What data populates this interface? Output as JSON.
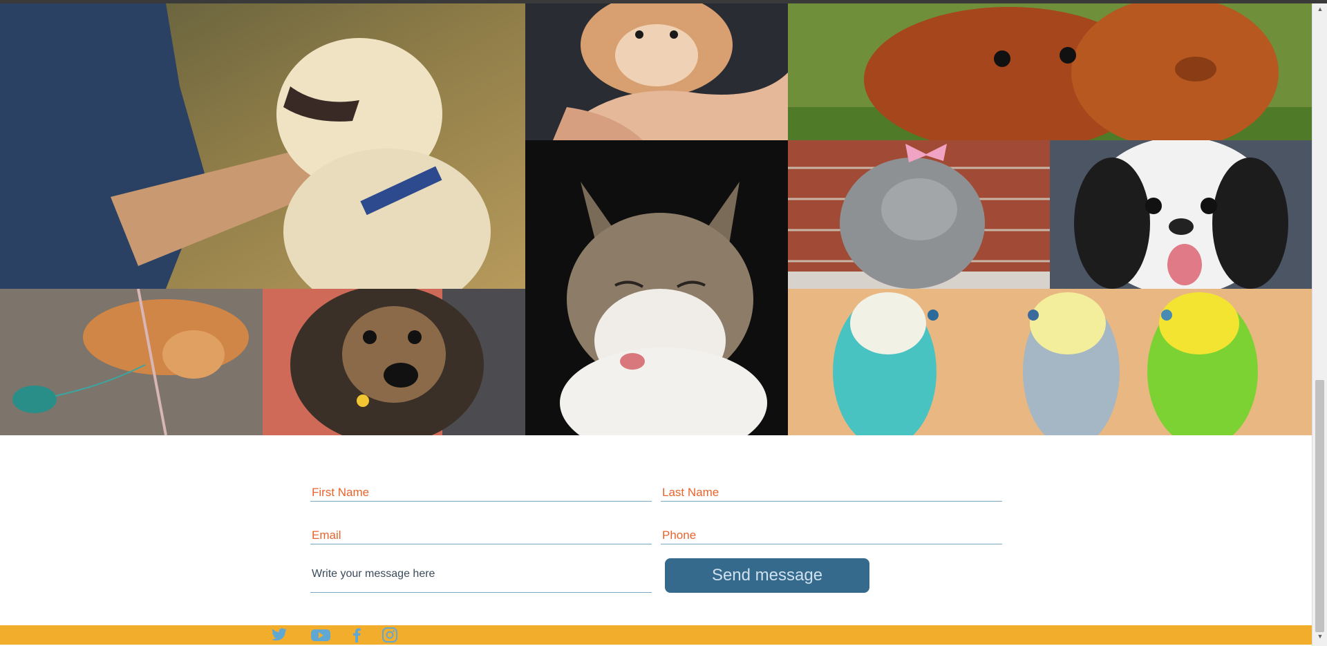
{
  "gallery": {
    "images": [
      {
        "subject": "man-petting-labrador"
      },
      {
        "subject": "hamster-in-hand"
      },
      {
        "subject": "guinea-pigs"
      },
      {
        "subject": "cat-tongue-out"
      },
      {
        "subject": "rabbit-with-bow"
      },
      {
        "subject": "japanese-chin-dog"
      },
      {
        "subject": "cat-playing-toy"
      },
      {
        "subject": "shepherd-mix-dog"
      },
      {
        "subject": "three-budgies"
      }
    ]
  },
  "form": {
    "first_name_placeholder": "First Name",
    "last_name_placeholder": "Last Name",
    "email_placeholder": "Email",
    "phone_placeholder": "Phone",
    "message_placeholder": "Write your message here",
    "send_label": "Send message"
  },
  "footer": {
    "social": [
      {
        "icon": "twitter-icon"
      },
      {
        "icon": "youtube-icon"
      },
      {
        "icon": "facebook-icon"
      },
      {
        "icon": "instagram-icon"
      }
    ]
  },
  "colors": {
    "accent_orange": "#e8642c",
    "button_blue": "#356a8d",
    "footer_yellow": "#f3ad2d",
    "social_icon": "#5fa8d3"
  }
}
